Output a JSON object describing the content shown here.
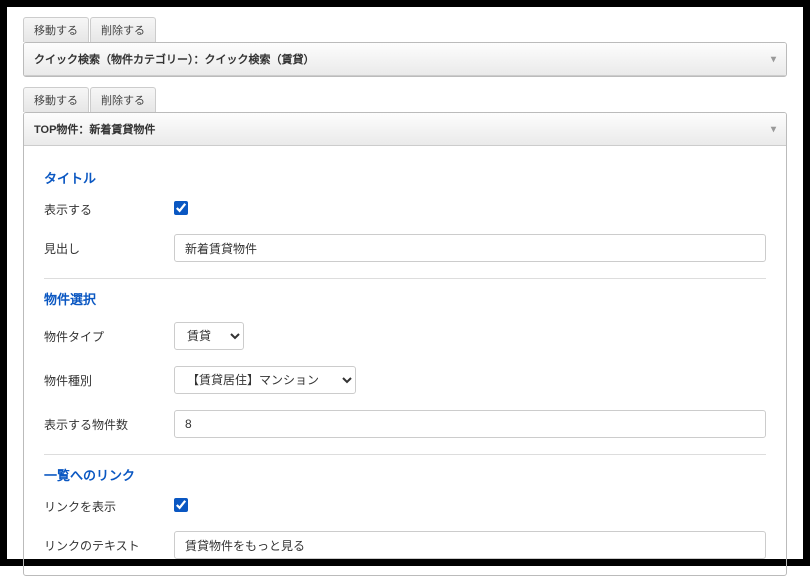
{
  "block1": {
    "tabs": {
      "move": "移動する",
      "delete": "削除する"
    },
    "header": "クイック検索（物件カテゴリー）：クイック検索（賃貸）"
  },
  "block2": {
    "tabs": {
      "move": "移動する",
      "delete": "削除する"
    },
    "header": "TOP物件：新着賃貸物件",
    "sections": {
      "title": {
        "heading": "タイトル",
        "show_label": "表示する",
        "show_checked": true,
        "headline_label": "見出し",
        "headline_value": "新着賃貸物件"
      },
      "select": {
        "heading": "物件選択",
        "type_label": "物件タイプ",
        "type_value": "賃貸",
        "kind_label": "物件種別",
        "kind_value": "【賃貸居住】マンション",
        "count_label": "表示する物件数",
        "count_value": "8"
      },
      "link": {
        "heading": "一覧へのリンク",
        "show_label": "リンクを表示",
        "show_checked": true,
        "text_label": "リンクのテキスト",
        "text_value": "賃貸物件をもっと見る"
      }
    }
  }
}
